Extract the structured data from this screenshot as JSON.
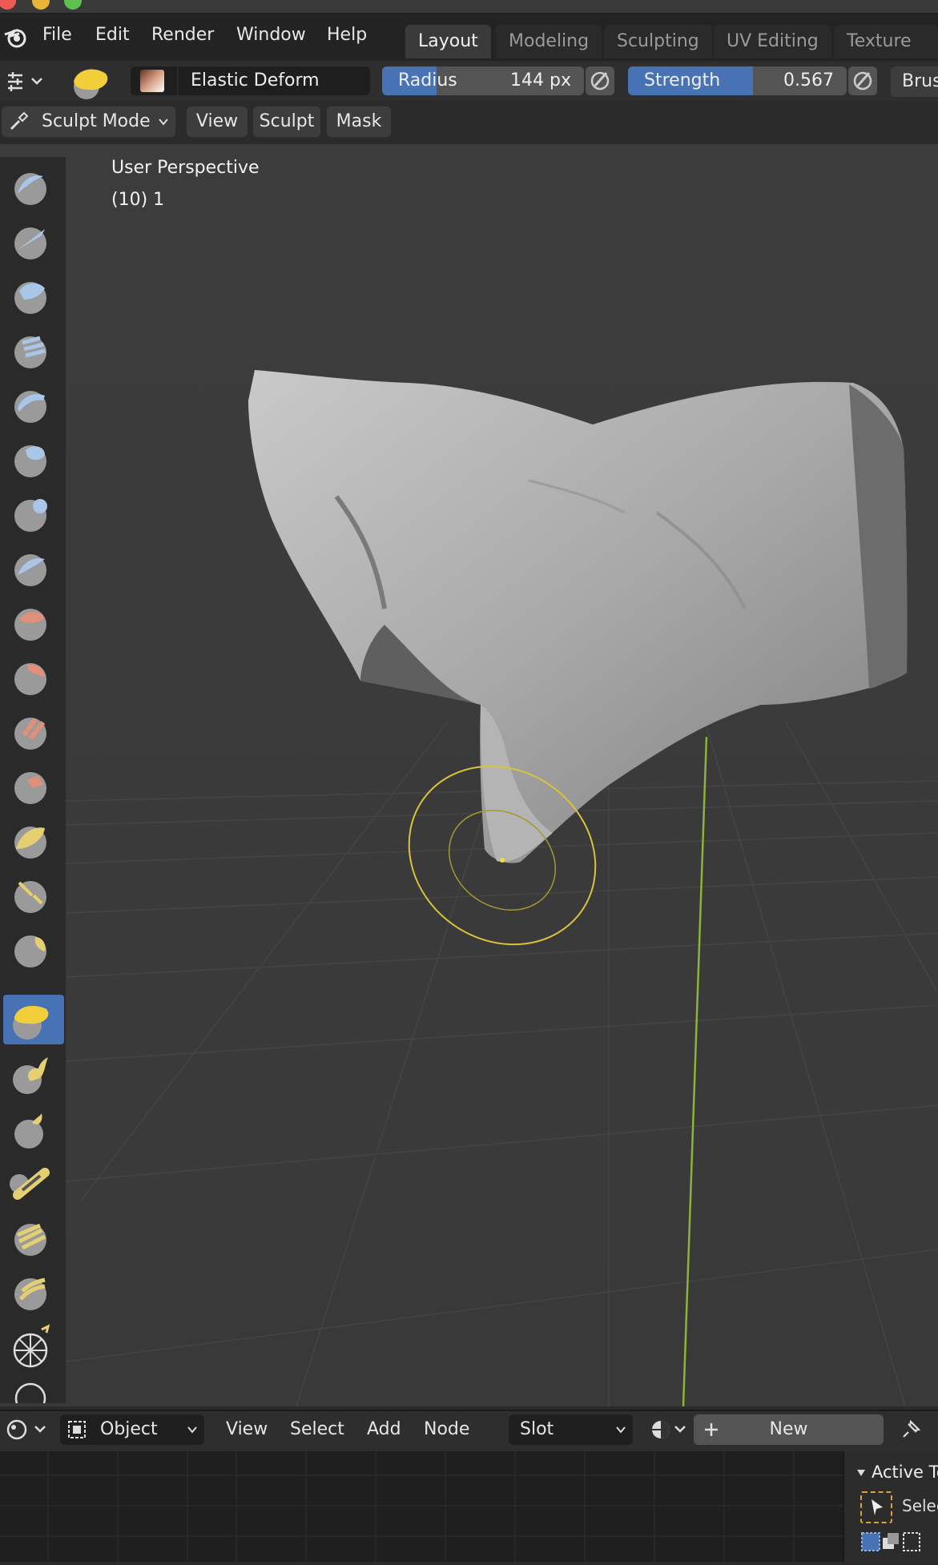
{
  "menubar": {
    "items": [
      "File",
      "Edit",
      "Render",
      "Window",
      "Help"
    ],
    "workspaces": [
      "Layout",
      "Modeling",
      "Sculpting",
      "UV Editing",
      "Texture Pai"
    ],
    "active_workspace": "Layout"
  },
  "toolbar": {
    "brush_name": "Elastic Deform",
    "radius": {
      "label": "Radius",
      "value": "144 px",
      "fill_fraction": 0.27
    },
    "strength": {
      "label": "Strength",
      "value": "0.567",
      "fill_fraction": 0.57
    },
    "brush_cut": "Brus"
  },
  "modebar": {
    "mode": "Sculpt Mode",
    "menus": [
      "View",
      "Sculpt",
      "Mask"
    ]
  },
  "viewport": {
    "perspective": "User Perspective",
    "object_info": "(10) 1"
  },
  "bottombar": {
    "object_mode": "Object",
    "menus": [
      "View",
      "Select",
      "Add",
      "Node"
    ],
    "slot": "Slot",
    "new_label": "New"
  },
  "sidepanel": {
    "active_tool_header": "Active To",
    "select_label": "Selec"
  },
  "colors": {
    "accent": "#4772b3",
    "brush_circle": "#d8c43a",
    "y_axis": "#8cb33a"
  }
}
